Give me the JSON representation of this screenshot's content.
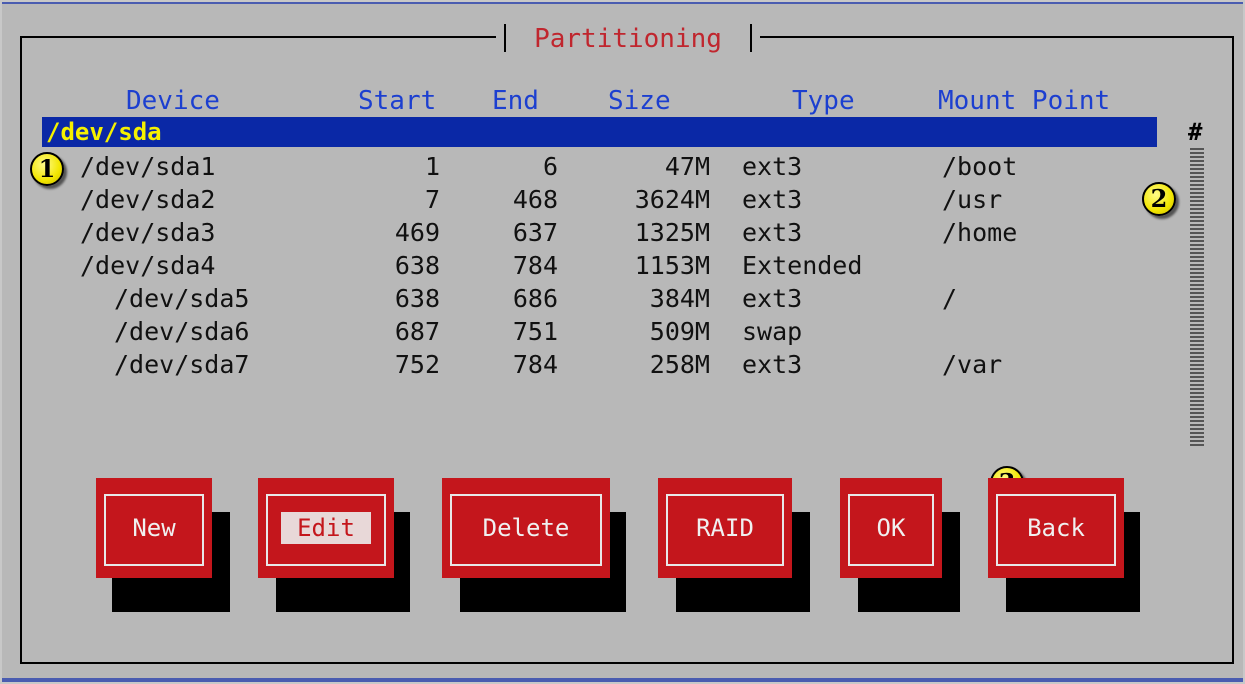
{
  "dialog": {
    "title": "Partitioning"
  },
  "columns": [
    "Device",
    "Start",
    "End",
    "Size",
    "Type",
    "Mount Point"
  ],
  "drive": "/dev/sda",
  "partitions": [
    {
      "device": "/dev/sda1",
      "start": "1",
      "end": "6",
      "size": "47M",
      "type": "ext3",
      "mount": "/boot"
    },
    {
      "device": "/dev/sda2",
      "start": "7",
      "end": "468",
      "size": "3624M",
      "type": "ext3",
      "mount": "/usr"
    },
    {
      "device": "/dev/sda3",
      "start": "469",
      "end": "637",
      "size": "1325M",
      "type": "ext3",
      "mount": "/home"
    },
    {
      "device": "/dev/sda4",
      "start": "638",
      "end": "784",
      "size": "1153M",
      "type": "Extended",
      "mount": ""
    },
    {
      "device": "/dev/sda5",
      "start": "638",
      "end": "686",
      "size": "384M",
      "type": "ext3",
      "mount": "/"
    },
    {
      "device": "/dev/sda6",
      "start": "687",
      "end": "751",
      "size": "509M",
      "type": "swap",
      "mount": ""
    },
    {
      "device": "/dev/sda7",
      "start": "752",
      "end": "784",
      "size": "258M",
      "type": "ext3",
      "mount": "/var"
    }
  ],
  "scrollbar": {
    "marker": "#"
  },
  "buttons": {
    "new": "New",
    "edit": "Edit",
    "delete": "Delete",
    "raid": "RAID",
    "ok": "OK",
    "back": "Back"
  },
  "callouts": [
    "1",
    "2",
    "3"
  ],
  "colors": {
    "button": "#c4161c",
    "selected_row": "#0a28a6",
    "selected_text": "#f5f100",
    "header": "#1c3fd0",
    "title": "#c0262e"
  }
}
